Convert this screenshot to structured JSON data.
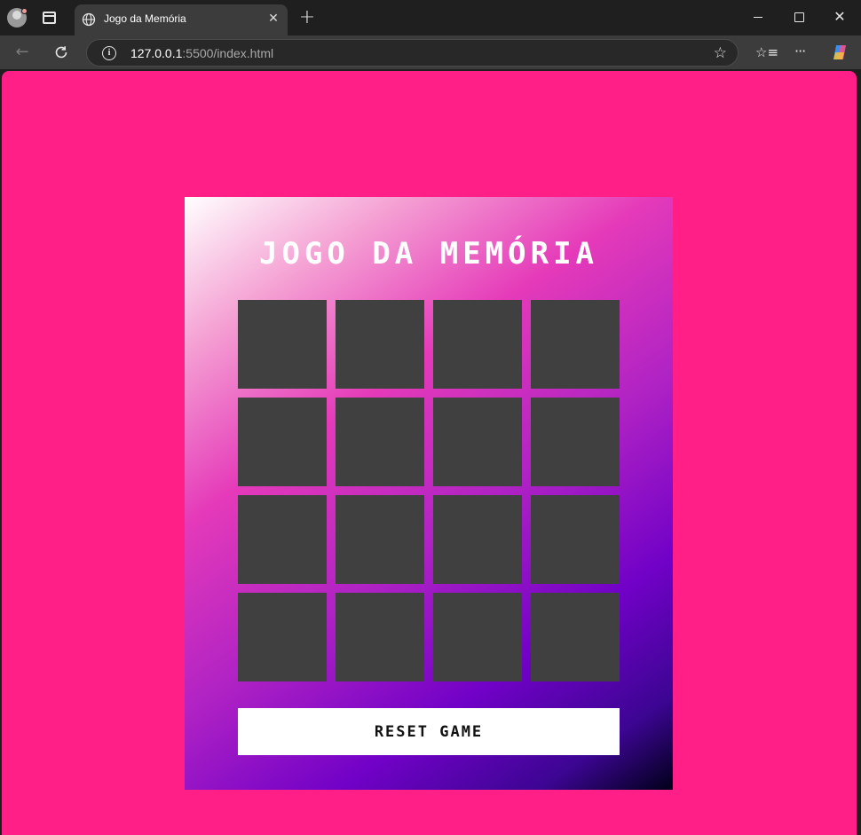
{
  "browser": {
    "tab_title": "Jogo da Memória",
    "tab_close": "✕",
    "new_tab": "+",
    "url_host": "127.0.0.1",
    "url_rest": ":5500/index.html",
    "icons": {
      "profile": "profile-avatar-icon",
      "tab_actions": "tab-actions-icon",
      "favicon": "globe-icon",
      "back": "arrow-left-icon",
      "reload": "reload-icon",
      "info": "info-icon",
      "star": "star-icon",
      "favorites": "favorites-icon",
      "more": "more-icon",
      "copilot": "copilot-icon"
    }
  },
  "game": {
    "title": "JOGO DA MEMÓRIA",
    "reset_label": "RESET GAME",
    "card_count": 16,
    "cards_faced_down": true,
    "colors": {
      "page_background": "#ff1f87",
      "card_back": "#404040",
      "button_background": "#ffffff",
      "title_text": "#ffffff"
    }
  }
}
